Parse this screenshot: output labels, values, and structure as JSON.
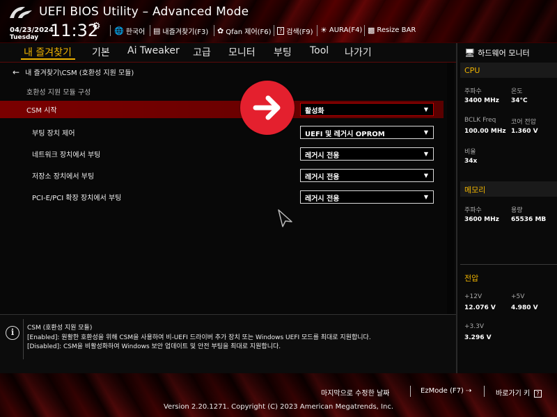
{
  "header": {
    "title": "UEFI BIOS Utility – Advanced Mode",
    "date": "04/23/2024",
    "day": "Tuesday",
    "time": "11:32",
    "tools": [
      {
        "icon": "globe-icon",
        "label": "한국어"
      },
      {
        "icon": "favorites-icon",
        "label": "내즐겨찾기(F3)"
      },
      {
        "icon": "fan-icon",
        "label": "Qfan 제어(F6)"
      },
      {
        "icon": "search-help-icon",
        "label": "검색(F9)"
      },
      {
        "icon": "aura-icon",
        "label": "AURA(F4)"
      },
      {
        "icon": "resize-bar-icon",
        "label": "Resize BAR"
      }
    ]
  },
  "menu": {
    "items": [
      "내 즐겨찾기",
      "기본",
      "Ai Tweaker",
      "고급",
      "모니터",
      "부팅",
      "Tool",
      "나가기"
    ],
    "active_index": 0
  },
  "main": {
    "breadcrumb": "내 즐겨찾기\\CSM (호환성 지원 모듈)",
    "section_title": "호환성 지원 모듈 구성",
    "settings": [
      {
        "label": "CSM 시작",
        "value": "활성화",
        "highlighted": true
      },
      {
        "label": "부팅 장치 제어",
        "value": "UEFI 및 레거시 OPROM",
        "highlighted": false
      },
      {
        "label": "네트워크 장치에서 부팅",
        "value": "레거시 전용",
        "highlighted": false
      },
      {
        "label": "저장소 장치에서 부팅",
        "value": "레거시 전용",
        "highlighted": false
      },
      {
        "label": "PCI-E/PCI 확장 장치에서 부팅",
        "value": "레거시 전용",
        "highlighted": false
      }
    ]
  },
  "help": {
    "title": "CSM (호환성 지원 모듈)",
    "enabled": "[Enabled]:  원활한 호환성을 위해 CSM을 사용하여 비-UEFI 드라이버 추가 장치 또는 Windows UEFI 모드를 최대로 지원합니다.",
    "disabled": "[Disabled]: CSM을 비활성화하여 Windows 보안 업데이트 및 안전 부팅을 최대로 지원합니다."
  },
  "monitor": {
    "title": "하드웨어 모니터",
    "cpu": {
      "heading": "CPU",
      "freq_label": "주파수",
      "freq": "3400 MHz",
      "temp_label": "온도",
      "temp": "34°C",
      "bclk_label": "BCLK Freq",
      "bclk": "100.00 MHz",
      "vcore_label": "코어 전압",
      "vcore": "1.360 V",
      "ratio_label": "비율",
      "ratio": "34x"
    },
    "memory": {
      "heading": "메모리",
      "freq_label": "주파수",
      "freq": "3600 MHz",
      "cap_label": "용량",
      "cap": "65536 MB"
    },
    "voltage": {
      "heading": "전압",
      "v12_label": "+12V",
      "v12": "12.076 V",
      "v5_label": "+5V",
      "v5": "4.980 V",
      "v33_label": "+3.3V",
      "v33": "3.296 V"
    }
  },
  "footer": {
    "last_modified": "마지막으로 수정한 날짜",
    "ezmode": "EzMode (F7)",
    "hotkeys": "바로가기 키",
    "version": "Version 2.20.1271. Copyright (C) 2023 American Megatrends, Inc."
  }
}
